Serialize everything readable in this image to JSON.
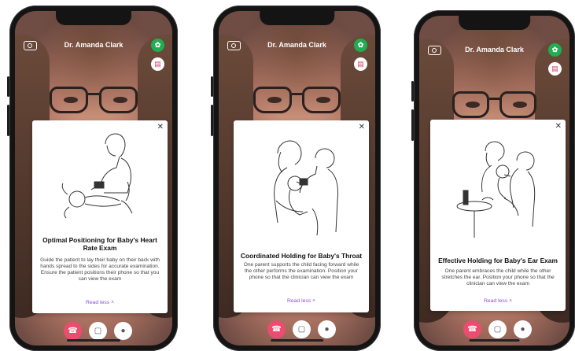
{
  "header": {
    "doctor_name": "Dr. Amanda Clark"
  },
  "icons": {
    "camera": "camera-icon",
    "status": "leaf-status-icon",
    "kit": "medical-kit-icon",
    "close": "close-icon",
    "end_call": "phone-hangup-icon",
    "video": "video-camera-icon",
    "mic": "microphone-icon",
    "chevron": "chevron-up-icon"
  },
  "colors": {
    "accent": "#8a4fd6",
    "end_call": "#ec4d6e",
    "status_green": "#1fae52"
  },
  "phones": [
    {
      "card_title": "Optimal Positioning for Baby's Heart Rate Exam",
      "card_description": "Guide the patient to lay their baby on their back with hands spread to the sides for accurate examination. Ensure the patient positions their phone so that you can view the exam",
      "read_less": "Read less"
    },
    {
      "card_title": "Coordinated Holding for Baby's Throat",
      "card_description": "One parent supports the child facing forward while the other performs the examination. Position your phone so that the clinician can view the exam",
      "read_less": "Read less"
    },
    {
      "card_title": "Effective Holding for Baby's Ear Exam",
      "card_description": "One parent embraces the child while the other stretches the ear. Position your phone so that the clinician can view the exam",
      "read_less": "Read less"
    }
  ]
}
